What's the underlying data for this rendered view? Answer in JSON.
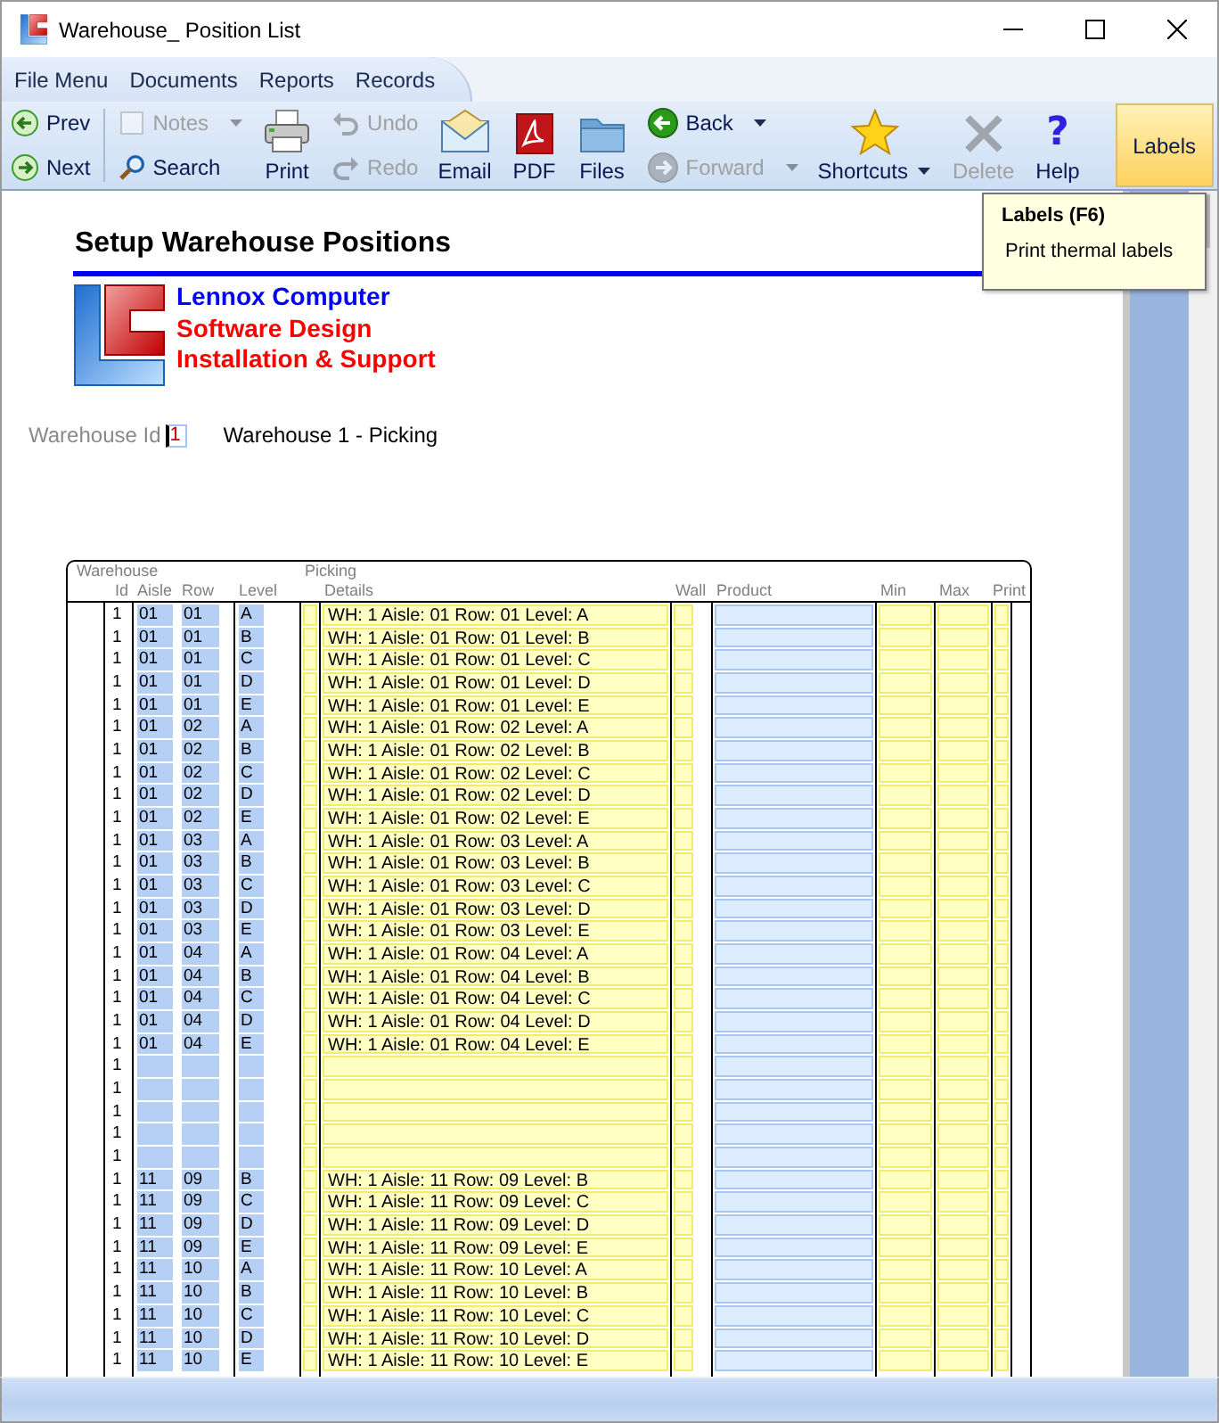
{
  "window": {
    "title": "Warehouse_ Position List"
  },
  "menu": [
    "File Menu",
    "Documents",
    "Reports",
    "Records"
  ],
  "toolbar": [
    {
      "kind": "pair",
      "items": [
        {
          "label": "Prev",
          "disabled": false,
          "dropdown": false
        },
        {
          "label": "Next",
          "disabled": false,
          "dropdown": false
        }
      ]
    },
    {
      "kind": "pair",
      "items": [
        {
          "label": "Notes",
          "disabled": true,
          "dropdown": true
        },
        {
          "label": "Search",
          "disabled": false,
          "dropdown": false
        }
      ]
    },
    {
      "kind": "big",
      "label": "Print",
      "disabled": false,
      "dropdown": false,
      "highlighted": false
    },
    {
      "kind": "pair",
      "items": [
        {
          "label": "Undo",
          "disabled": true,
          "dropdown": false
        },
        {
          "label": "Redo",
          "disabled": true,
          "dropdown": false
        }
      ]
    },
    {
      "kind": "big",
      "label": "Email",
      "disabled": false,
      "dropdown": false,
      "highlighted": false
    },
    {
      "kind": "big",
      "label": "PDF",
      "disabled": false,
      "dropdown": false,
      "highlighted": false
    },
    {
      "kind": "big",
      "label": "Files",
      "disabled": false,
      "dropdown": false,
      "highlighted": false
    },
    {
      "kind": "pair",
      "items": [
        {
          "label": "Back",
          "disabled": false,
          "dropdown": true
        },
        {
          "label": "Forward",
          "disabled": true,
          "dropdown": true
        }
      ]
    },
    {
      "kind": "big",
      "label": "Shortcuts",
      "disabled": false,
      "dropdown": true,
      "highlighted": false
    },
    {
      "kind": "big",
      "label": "Delete",
      "disabled": true,
      "dropdown": false,
      "highlighted": false
    },
    {
      "kind": "big",
      "label": "Help",
      "glyph": "?",
      "disabled": false,
      "dropdown": false,
      "highlighted": false
    },
    {
      "kind": "big",
      "label": "Labels",
      "disabled": false,
      "dropdown": false,
      "highlighted": true
    }
  ],
  "tooltip": {
    "title": "Labels (F6)",
    "text": "Print thermal labels"
  },
  "page": {
    "title": "Setup Warehouse Positions",
    "company": [
      {
        "text": "Lennox Computer",
        "color": "#0000ff"
      },
      {
        "text": "Software Design",
        "color": "#ff0000"
      },
      {
        "text": "Installation & Support",
        "color": "#ff0000"
      }
    ],
    "warehouse_id": {
      "label": "Warehouse Id",
      "value": "1",
      "name": "Warehouse 1 - Picking"
    }
  },
  "table": {
    "groups": [
      "Warehouse",
      "Picking"
    ],
    "columns": [
      "Id",
      "Aisle",
      "Row",
      "Level",
      "Details",
      "Wall",
      "Product",
      "Min",
      "Max",
      "Print"
    ],
    "rows": [
      {
        "id": "1",
        "aisle": "01",
        "row": "01",
        "level": "A",
        "details": "WH: 1 Aisle: 01 Row: 01 Level: A"
      },
      {
        "id": "1",
        "aisle": "01",
        "row": "01",
        "level": "B",
        "details": "WH: 1 Aisle: 01 Row: 01 Level: B"
      },
      {
        "id": "1",
        "aisle": "01",
        "row": "01",
        "level": "C",
        "details": "WH: 1 Aisle: 01 Row: 01 Level: C"
      },
      {
        "id": "1",
        "aisle": "01",
        "row": "01",
        "level": "D",
        "details": "WH: 1 Aisle: 01 Row: 01 Level: D"
      },
      {
        "id": "1",
        "aisle": "01",
        "row": "01",
        "level": "E",
        "details": "WH: 1 Aisle: 01 Row: 01 Level: E"
      },
      {
        "id": "1",
        "aisle": "01",
        "row": "02",
        "level": "A",
        "details": "WH: 1 Aisle: 01 Row: 02 Level: A"
      },
      {
        "id": "1",
        "aisle": "01",
        "row": "02",
        "level": "B",
        "details": "WH: 1 Aisle: 01 Row: 02 Level: B"
      },
      {
        "id": "1",
        "aisle": "01",
        "row": "02",
        "level": "C",
        "details": "WH: 1 Aisle: 01 Row: 02 Level: C"
      },
      {
        "id": "1",
        "aisle": "01",
        "row": "02",
        "level": "D",
        "details": "WH: 1 Aisle: 01 Row: 02 Level: D"
      },
      {
        "id": "1",
        "aisle": "01",
        "row": "02",
        "level": "E",
        "details": "WH: 1 Aisle: 01 Row: 02 Level: E"
      },
      {
        "id": "1",
        "aisle": "01",
        "row": "03",
        "level": "A",
        "details": "WH: 1 Aisle: 01 Row: 03 Level: A"
      },
      {
        "id": "1",
        "aisle": "01",
        "row": "03",
        "level": "B",
        "details": "WH: 1 Aisle: 01 Row: 03 Level: B"
      },
      {
        "id": "1",
        "aisle": "01",
        "row": "03",
        "level": "C",
        "details": "WH: 1 Aisle: 01 Row: 03 Level: C"
      },
      {
        "id": "1",
        "aisle": "01",
        "row": "03",
        "level": "D",
        "details": "WH: 1 Aisle: 01 Row: 03 Level: D"
      },
      {
        "id": "1",
        "aisle": "01",
        "row": "03",
        "level": "E",
        "details": "WH: 1 Aisle: 01 Row: 03 Level: E"
      },
      {
        "id": "1",
        "aisle": "01",
        "row": "04",
        "level": "A",
        "details": "WH: 1 Aisle: 01 Row: 04 Level: A"
      },
      {
        "id": "1",
        "aisle": "01",
        "row": "04",
        "level": "B",
        "details": "WH: 1 Aisle: 01 Row: 04 Level: B"
      },
      {
        "id": "1",
        "aisle": "01",
        "row": "04",
        "level": "C",
        "details": "WH: 1 Aisle: 01 Row: 04 Level: C"
      },
      {
        "id": "1",
        "aisle": "01",
        "row": "04",
        "level": "D",
        "details": "WH: 1 Aisle: 01 Row: 04 Level: D"
      },
      {
        "id": "1",
        "aisle": "01",
        "row": "04",
        "level": "E",
        "details": "WH: 1 Aisle: 01 Row: 04 Level: E"
      },
      {
        "id": "1"
      },
      {
        "id": "1"
      },
      {
        "id": "1"
      },
      {
        "id": "1"
      },
      {
        "id": "1"
      },
      {
        "id": "1",
        "aisle": "11",
        "row": "09",
        "level": "B",
        "details": "WH: 1 Aisle: 11 Row: 09 Level: B"
      },
      {
        "id": "1",
        "aisle": "11",
        "row": "09",
        "level": "C",
        "details": "WH: 1 Aisle: 11 Row: 09 Level: C"
      },
      {
        "id": "1",
        "aisle": "11",
        "row": "09",
        "level": "D",
        "details": "WH: 1 Aisle: 11 Row: 09 Level: D"
      },
      {
        "id": "1",
        "aisle": "11",
        "row": "09",
        "level": "E",
        "details": "WH: 1 Aisle: 11 Row: 09 Level: E"
      },
      {
        "id": "1",
        "aisle": "11",
        "row": "10",
        "level": "A",
        "details": "WH: 1 Aisle: 11 Row: 10 Level: A"
      },
      {
        "id": "1",
        "aisle": "11",
        "row": "10",
        "level": "B",
        "details": "WH: 1 Aisle: 11 Row: 10 Level: B"
      },
      {
        "id": "1",
        "aisle": "11",
        "row": "10",
        "level": "C",
        "details": "WH: 1 Aisle: 11 Row: 10 Level: C"
      },
      {
        "id": "1",
        "aisle": "11",
        "row": "10",
        "level": "D",
        "details": "WH: 1 Aisle: 11 Row: 10 Level: D"
      },
      {
        "id": "1",
        "aisle": "11",
        "row": "10",
        "level": "E",
        "details": "WH: 1 Aisle: 11 Row: 10 Level: E"
      }
    ]
  }
}
